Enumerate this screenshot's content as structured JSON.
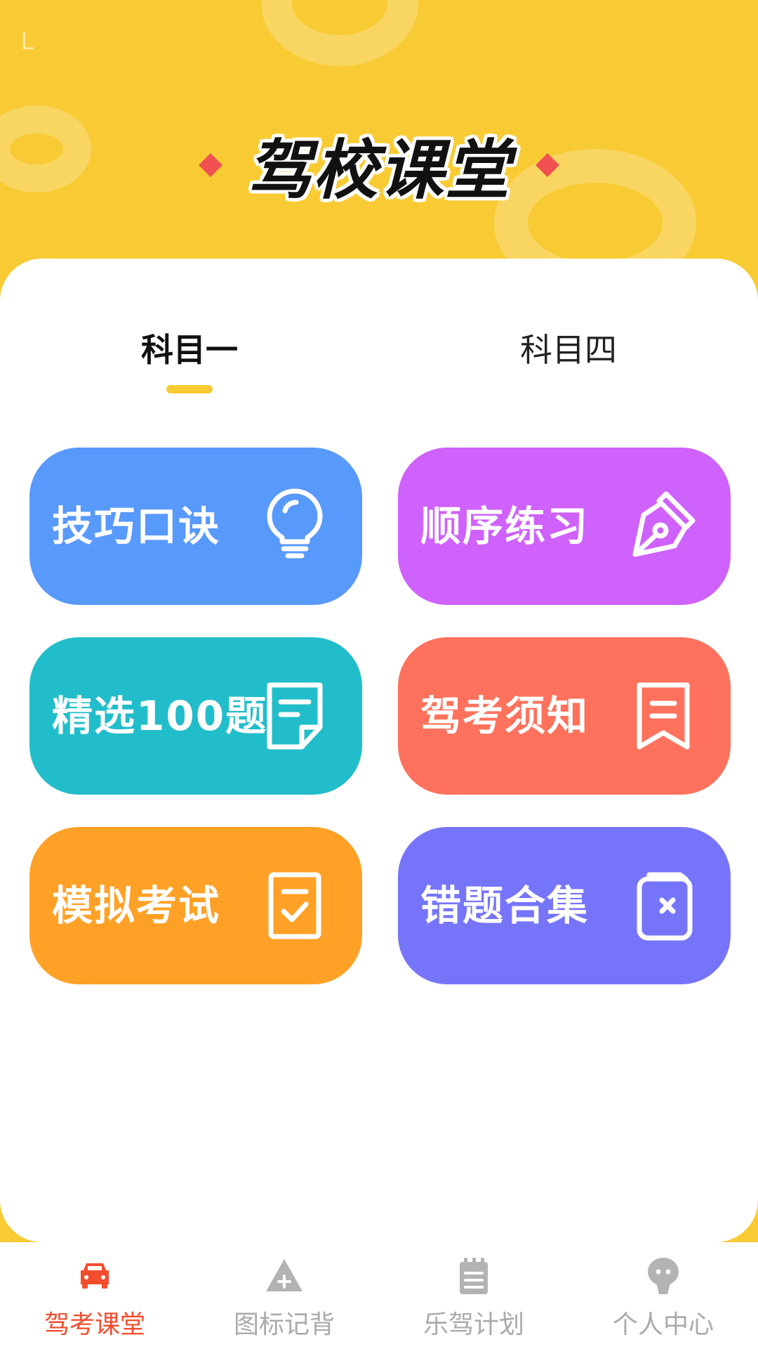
{
  "status": {
    "left_glyph": "L"
  },
  "header": {
    "title": "驾校课堂"
  },
  "tabs": [
    {
      "label": "科目一",
      "active": true
    },
    {
      "label": "科目四",
      "active": false
    }
  ],
  "cards": [
    {
      "label": "技巧口诀",
      "icon": "lightbulb-icon",
      "color": "#5899FC"
    },
    {
      "label": "顺序练习",
      "icon": "pen-nib-icon",
      "color": "#CF61FC"
    },
    {
      "label": "精选100题",
      "icon": "document-icon",
      "color": "#22BDCA"
    },
    {
      "label": "驾考须知",
      "icon": "bookmark-icon",
      "color": "#FE725D"
    },
    {
      "label": "模拟考试",
      "icon": "checklist-icon",
      "color": "#FFA126"
    },
    {
      "label": "错题合集",
      "icon": "error-book-icon",
      "color": "#7675F9"
    }
  ],
  "nav": [
    {
      "label": "驾考课堂",
      "icon": "car-icon",
      "active": true
    },
    {
      "label": "图标记背",
      "icon": "warning-sign-icon",
      "active": false
    },
    {
      "label": "乐驾计划",
      "icon": "notepad-icon",
      "active": false
    },
    {
      "label": "个人中心",
      "icon": "profile-icon",
      "active": false
    }
  ],
  "colors": {
    "accent": "#F8CB35",
    "nav_active": "#F24E2E",
    "nav_inactive": "#AAAAAA",
    "diamond": "#F25151"
  }
}
